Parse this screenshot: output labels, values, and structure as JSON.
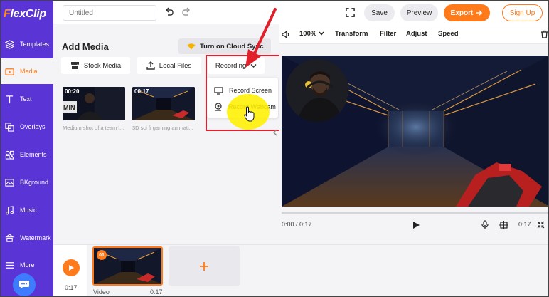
{
  "app": {
    "logo_text": "lexClip",
    "logo_initial": "F"
  },
  "sidebar": {
    "items": [
      {
        "label": "Templates",
        "icon": "layers-icon"
      },
      {
        "label": "Media",
        "icon": "media-folder-icon",
        "active": true
      },
      {
        "label": "Text",
        "icon": "text-icon"
      },
      {
        "label": "Overlays",
        "icon": "overlays-icon"
      },
      {
        "label": "Elements",
        "icon": "elements-icon"
      },
      {
        "label": "BKground",
        "icon": "background-icon"
      },
      {
        "label": "Music",
        "icon": "music-icon"
      },
      {
        "label": "Watermark",
        "icon": "watermark-icon"
      },
      {
        "label": "More",
        "icon": "more-icon"
      }
    ]
  },
  "topbar": {
    "title_placeholder": "Untitled",
    "save_label": "Save",
    "preview_label": "Preview",
    "export_label": "Export",
    "signup_label": "Sign Up"
  },
  "panel": {
    "title": "Add Media",
    "cloud_sync_label": "Turn on Cloud Sync",
    "tabs": {
      "stock": "Stock Media",
      "local": "Local Files",
      "recording": "Recording"
    },
    "media": [
      {
        "duration": "00:20",
        "caption": "Medium shot of a team l..."
      },
      {
        "duration": "00:17",
        "caption": "3D sci fi gaming animati..."
      }
    ],
    "recording_menu": {
      "screen": "Record Screen",
      "webcam": "Record Webcam"
    }
  },
  "preview": {
    "toolbar": {
      "zoom": "100%",
      "transform": "Transform",
      "filter": "Filter",
      "adjust": "Adjust",
      "speed": "Speed"
    },
    "time_current": "0:00 / 0:17",
    "time_total": "0:17"
  },
  "timeline": {
    "time": "0:17",
    "clip_number": "01",
    "clip_label": "Video",
    "clip_duration": "0:17"
  },
  "colors": {
    "sidebar": "#5b34d6",
    "accent": "#ff7a1a",
    "highlight_box": "#e0202a",
    "cursor_highlight": "#fff000"
  }
}
